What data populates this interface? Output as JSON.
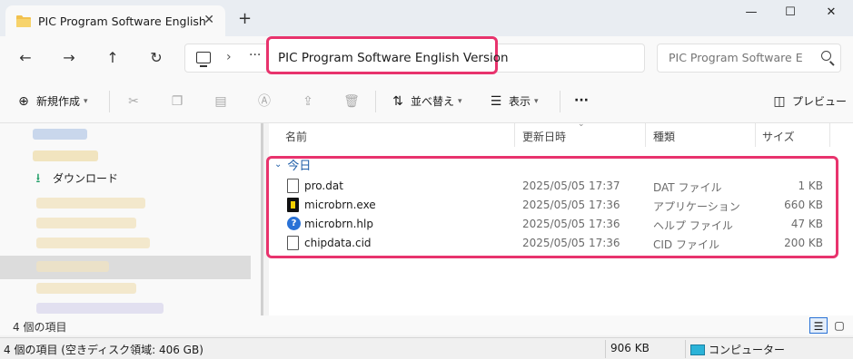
{
  "window": {
    "tab_title": "PIC Program Software English",
    "tab_close": "✕",
    "new_tab": "+",
    "minimize": "—",
    "maximize": "☐",
    "close": "✕"
  },
  "address": {
    "overflow": "···",
    "chevron": "›",
    "current_folder": "PIC Program Software English Version",
    "search_placeholder": "PIC Program Software E"
  },
  "commands": {
    "new": "新規作成",
    "sort": "並べ替え",
    "view": "表示",
    "more": "···",
    "preview": "プレビュー"
  },
  "sidebar": {
    "downloads": "ダウンロード"
  },
  "columns": {
    "name": "名前",
    "modified": "更新日時",
    "type": "種類",
    "size": "サイズ"
  },
  "group_label": "今日",
  "files": [
    {
      "name": "pro.dat",
      "modified": "2025/05/05 17:37",
      "type": "DAT ファイル",
      "size": "1 KB",
      "icon": "document-icon"
    },
    {
      "name": "microbrn.exe",
      "modified": "2025/05/05 17:36",
      "type": "アプリケーション",
      "size": "660 KB",
      "icon": "exe-icon"
    },
    {
      "name": "microbrn.hlp",
      "modified": "2025/05/05 17:36",
      "type": "ヘルプ ファイル",
      "size": "47 KB",
      "icon": "help-icon"
    },
    {
      "name": "chipdata.cid",
      "modified": "2025/05/05 17:36",
      "type": "CID ファイル",
      "size": "200 KB",
      "icon": "document-icon"
    }
  ],
  "status": {
    "item_count": "4 個の項目",
    "summary": "4 個の項目 (空きディスク領域: 406 GB)",
    "total_size": "906 KB",
    "location": "コンピューター"
  },
  "colors": {
    "highlight": "#e8336d",
    "group_text": "#1f5ea8",
    "folder": "#f2c14e"
  }
}
